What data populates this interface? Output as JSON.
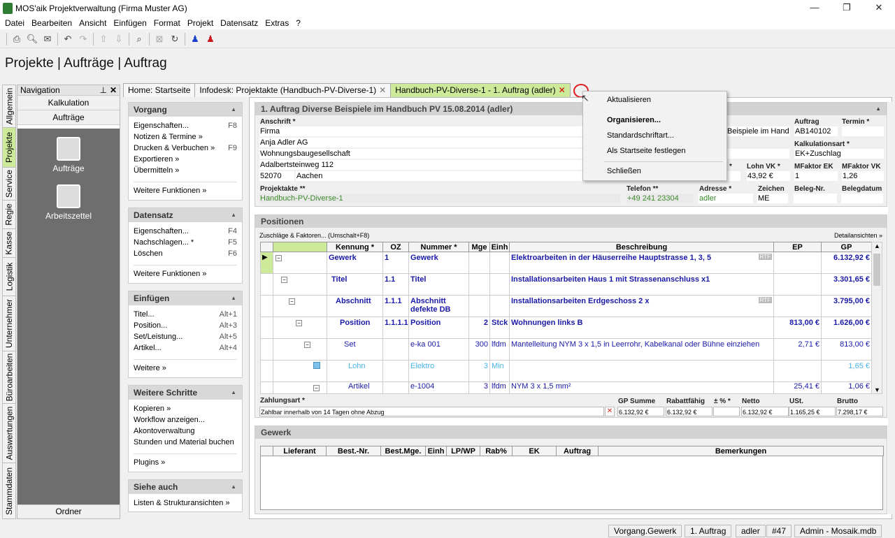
{
  "window": {
    "title": "MOS'aik Projektverwaltung (Firma Muster AG)",
    "minimize": "—",
    "maximize": "❐",
    "close": "✕"
  },
  "menu": [
    "Datei",
    "Bearbeiten",
    "Ansicht",
    "Einfügen",
    "Format",
    "Projekt",
    "Datensatz",
    "Extras",
    "?"
  ],
  "page_title": "Projekte | Aufträge | Auftrag",
  "vtabs": [
    "Allgemein",
    "Projekte",
    "Service",
    "Regie",
    "Kasse",
    "Logistik",
    "Unternehmer",
    "Büroarbeiten",
    "Auswertungen",
    "Stammdaten"
  ],
  "nav": {
    "header": "Navigation",
    "rows": [
      "Kalkulation",
      "Aufträge"
    ],
    "icons": [
      "Aufträge",
      "Arbeitszettel"
    ],
    "footer": "Ordner"
  },
  "doc_tabs": [
    "Home: Startseite",
    "Infodesk: Projektakte (Handbuch-PV-Diverse-1)",
    "Handbuch-PV-Diverse-1 - 1. Auftrag (adler)"
  ],
  "left": {
    "vorgang": {
      "title": "Vorgang",
      "items": [
        {
          "l": "Eigenschaften...",
          "k": "F8"
        },
        {
          "l": "Notizen & Termine »",
          "k": ""
        },
        {
          "l": "Drucken & Verbuchen »",
          "k": "F9"
        },
        {
          "l": "Exportieren »",
          "k": ""
        },
        {
          "l": "Übermitteln »",
          "k": ""
        }
      ],
      "more": "Weitere Funktionen »"
    },
    "datensatz": {
      "title": "Datensatz",
      "items": [
        {
          "l": "Eigenschaften...",
          "k": "F4"
        },
        {
          "l": "Nachschlagen... *",
          "k": "F5"
        },
        {
          "l": "Löschen",
          "k": "F6"
        }
      ],
      "more": "Weitere Funktionen »"
    },
    "einfuegen": {
      "title": "Einfügen",
      "items": [
        {
          "l": "Titel...",
          "k": "Alt+1"
        },
        {
          "l": "Position...",
          "k": "Alt+3"
        },
        {
          "l": "Set/Leistung...",
          "k": "Alt+5"
        },
        {
          "l": "Artikel...",
          "k": "Alt+4"
        }
      ],
      "more": "Weitere »"
    },
    "schritte": {
      "title": "Weitere Schritte",
      "items": [
        {
          "l": "Kopieren »",
          "k": ""
        },
        {
          "l": "Workflow anzeigen...",
          "k": ""
        },
        {
          "l": "Akontoverwaltung",
          "k": ""
        },
        {
          "l": "Stunden und Material buchen",
          "k": ""
        }
      ],
      "more": "Plugins »"
    },
    "siehe": {
      "title": "Siehe auch",
      "items": [
        {
          "l": "Listen & Strukturansichten »",
          "k": ""
        }
      ]
    }
  },
  "auftrag": {
    "header": "1. Auftrag Diverse Beispiele im Handbuch PV 15.08.2014 (adler)",
    "anschrift_label": "Anschrift *",
    "anschrift": [
      "Firma",
      "Anja Adler AG",
      "Wohnungsbaugesellschaft",
      "Adalbertsteinweg 112"
    ],
    "plz": "52070",
    "ort": "Aachen",
    "bez_frag": "Beispiele im Handb",
    "auftrag_label": "Auftrag",
    "auftrag": "AB140102",
    "termin_label": "Termin *",
    "termin": "",
    "kalk_label": "Kalkulationsart *",
    "kalk": "EK+Zuschlag",
    "lohn_vk_frag": "*",
    "lohn_vk_label": "Lohn VK *",
    "lohn_vk": "43,92 €",
    "mfek_label": "MFaktor EK",
    "mfek": "1",
    "mfvk_label": "MFaktor VK",
    "mfvk": "1,26",
    "projektakte_label": "Projektakte **",
    "projektakte": "Handbuch-PV-Diverse-1",
    "telefon_label": "Telefon **",
    "telefon": "+49 241 23304",
    "adresse_label": "Adresse *",
    "adresse": "adler",
    "zeichen_label": "Zeichen",
    "zeichen": "ME",
    "belegnr_label": "Beleg-Nr.",
    "belegnr": "",
    "belegdatum_label": "Belegdatum",
    "belegdatum": ""
  },
  "positionen": {
    "header": "Positionen",
    "zuschlaege": "Zuschläge & Faktoren... (Umschalt+F8)",
    "detail": "Detailansichten »",
    "columns": [
      "Kennung *",
      "OZ",
      "Nummer *",
      "Mge",
      "Einh",
      "Beschreibung",
      "EP",
      "GP"
    ],
    "rows": [
      {
        "kennung": "Gewerk",
        "oz": "1",
        "nummer": "Gewerk",
        "mge": "",
        "einh": "",
        "beschr": "Elektroarbeiten in der Häuserreihe Hauptstrasse 1, 3, 5",
        "ep": "",
        "gp": "6.132,92 €",
        "rtf": "RTF"
      },
      {
        "kennung": "Titel",
        "oz": "1.1",
        "nummer": "Titel",
        "mge": "",
        "einh": "",
        "beschr": "Installationsarbeiten Haus 1 mit Strassenanschluss x1",
        "ep": "",
        "gp": "3.301,65 €",
        "rtf": ""
      },
      {
        "kennung": "Abschnitt",
        "oz": "1.1.1",
        "nummer": "Abschnitt defekte DB",
        "mge": "",
        "einh": "",
        "beschr": "Installationsarbeiten Erdgeschoss 2 x",
        "ep": "",
        "gp": "3.795,00 €",
        "rtf": "RTF"
      },
      {
        "kennung": "Position",
        "oz": "1.1.1.1",
        "nummer": "Position",
        "mge": "2",
        "einh": "Stck",
        "beschr": "Wohnungen links B",
        "ep": "813,00 €",
        "gp": "1.626,00 €",
        "rtf": ""
      },
      {
        "kennung": "Set",
        "oz": "",
        "nummer": "e-ka 001",
        "mge": "300",
        "einh": "lfdm",
        "beschr": "Mantelleitung NYM 3 x 1,5 in Leerrohr, Kabelkanal oder Bühne einziehen",
        "ep": "2,71 €",
        "gp": "813,00 €",
        "rtf": ""
      },
      {
        "kennung": "Lohn",
        "oz": "",
        "nummer": "Elektro",
        "mge": "3",
        "einh": "Min",
        "beschr": "",
        "ep": "",
        "gp": "1,65 €",
        "rtf": ""
      },
      {
        "kennung": "Artikel",
        "oz": "",
        "nummer": "e-1004",
        "mge": "3",
        "einh": "lfdm",
        "beschr": "NYM 3 x 1,5 mm²",
        "ep": "25,41 €",
        "gp": "1,06 €",
        "rtf": ""
      }
    ],
    "zahlungsart_label": "Zahlungsart *",
    "zahlungsart": "Zahlbar innerhalb von 14 Tagen ohne Abzug",
    "totals_labels": [
      "GP Summe",
      "Rabattfähig",
      "± % *",
      "Netto",
      "USt.",
      "Brutto"
    ],
    "totals": [
      "6.132,92 €",
      "6.132,92 €",
      "",
      "6.132,92 €",
      "1.165,25 €",
      "7.298,17 €"
    ]
  },
  "gewerk": {
    "header": "Gewerk",
    "columns": [
      "Lieferant",
      "Best.-Nr.",
      "Best.Mge.",
      "Einh",
      "LP/WP",
      "Rab%",
      "EK",
      "Auftrag",
      "Bemerkungen"
    ]
  },
  "context_menu": [
    "Aktualisieren",
    "Organisieren...",
    "Standardschriftart...",
    "Als Startseite festlegen",
    "Schließen"
  ],
  "status": [
    "Vorgang.Gewerk",
    "1. Auftrag",
    "adler",
    "#47",
    "Admin - Mosaik.mdb"
  ],
  "colors": {
    "accent": "#cde99a",
    "blue_text": "#1a1aa8",
    "light_blue": "#4ab4ea",
    "green_text": "#3a8a2a"
  }
}
